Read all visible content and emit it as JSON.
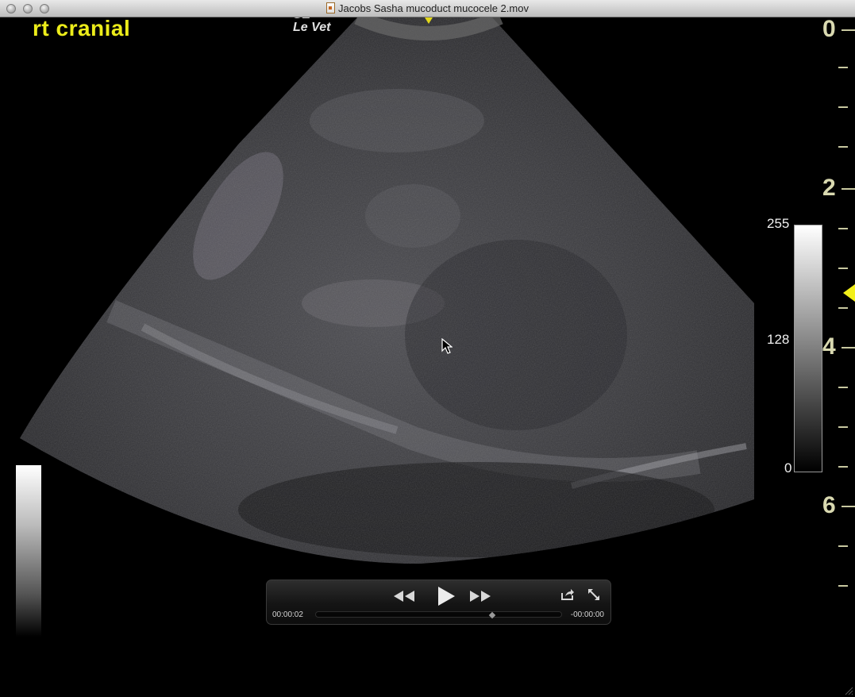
{
  "window": {
    "title": "Jacobs Sasha mucoduct mucocele 2.mov"
  },
  "overlay": {
    "view_label": "rt cranial",
    "brand_top": "GE",
    "brand": "Le Vet"
  },
  "depth_scale": {
    "major_labels": [
      "0",
      "2",
      "4",
      "6"
    ]
  },
  "grayscale_bar": {
    "max": "255",
    "mid": "128",
    "min": "0"
  },
  "player": {
    "elapsed": "00:00:02",
    "remaining": "-00:00:00",
    "playhead_fraction": 0.72,
    "icons": [
      "rewind-icon",
      "play-icon",
      "fast-forward-icon",
      "share-icon",
      "fullscreen-icon"
    ]
  },
  "colors": {
    "overlay_yellow": "#ECEC1A",
    "depth_scale": "#D9D9B0"
  }
}
